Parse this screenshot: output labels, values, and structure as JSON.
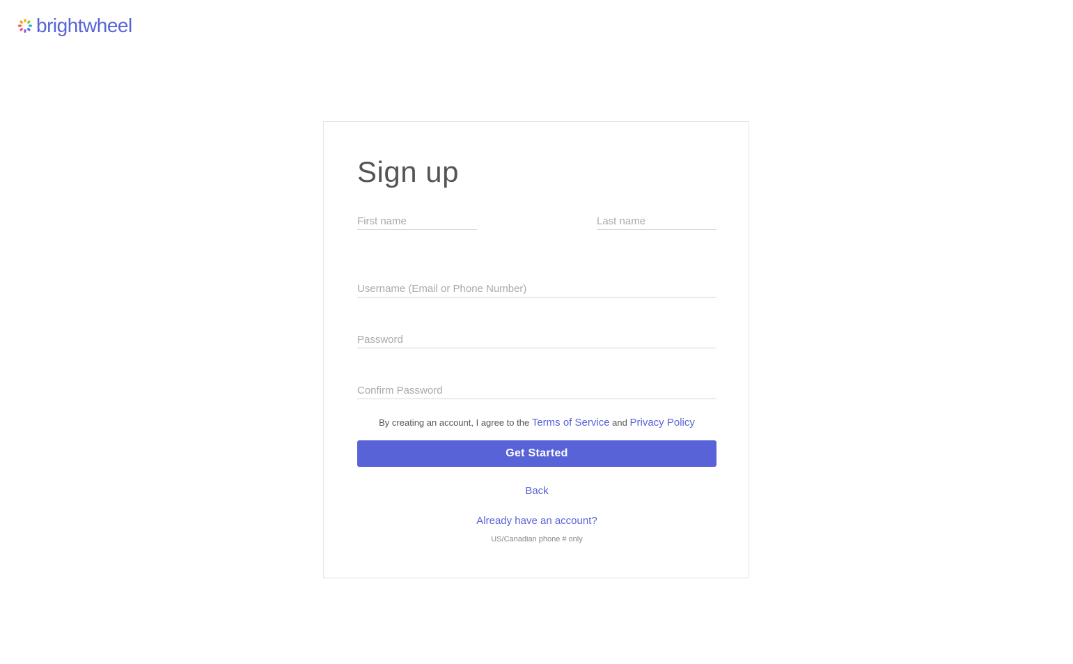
{
  "header": {
    "logo_text": "brightwheel"
  },
  "form": {
    "title": "Sign up",
    "first_name_placeholder": "First name",
    "last_name_placeholder": "Last name",
    "username_placeholder": "Username (Email or Phone Number)",
    "password_placeholder": "Password",
    "confirm_password_placeholder": "Confirm Password",
    "agree_prefix": "By creating an account, I agree to the",
    "terms_label": "Terms of Service",
    "agree_and": "and",
    "privacy_label": "Privacy Policy",
    "submit_label": "Get Started",
    "back_label": "Back",
    "have_account_label": "Already have an account?",
    "phone_note": "US/Canadian phone # only"
  },
  "colors": {
    "brand": "#5863d8",
    "border": "#e5e5e5",
    "placeholder": "#a9a9a9"
  },
  "icons": {
    "logo": "brightwheel-logo-icon"
  }
}
